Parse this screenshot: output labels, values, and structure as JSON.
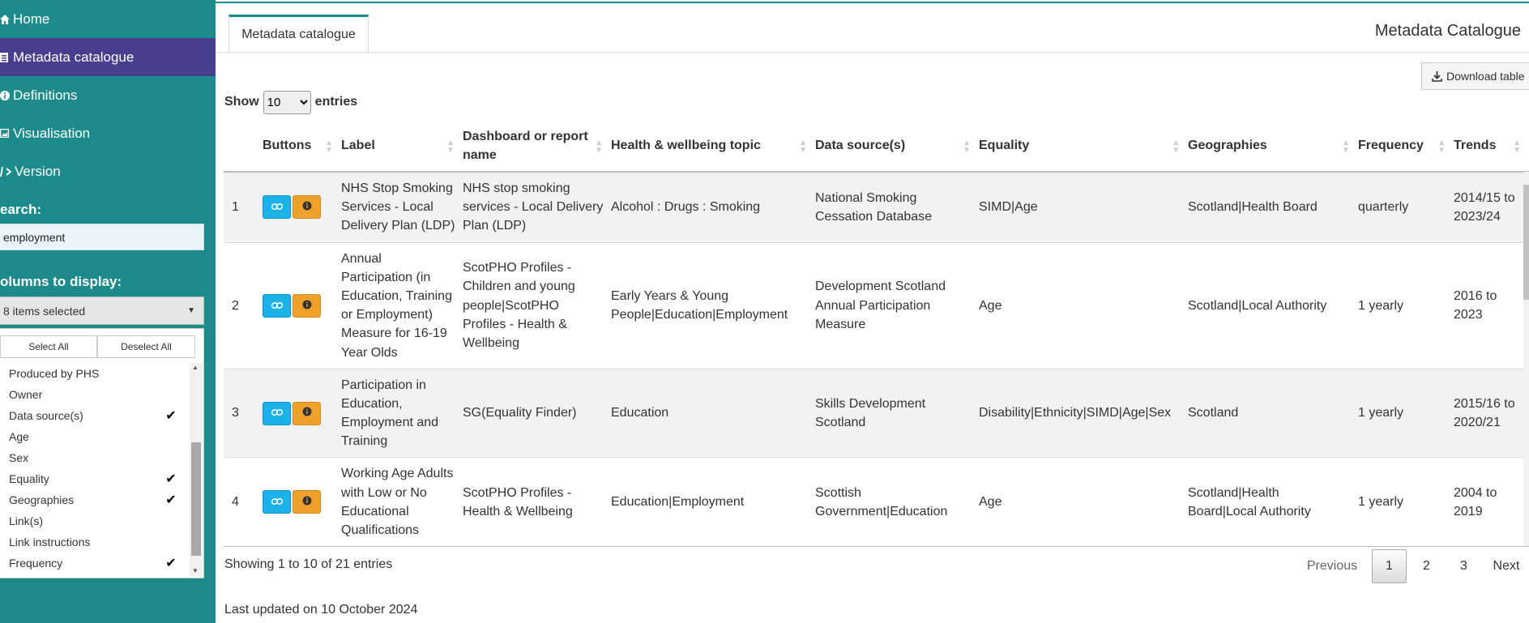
{
  "sidebar": {
    "nav": [
      {
        "label": "Home",
        "icon": "home-icon"
      },
      {
        "label": "Metadata catalogue",
        "icon": "table-icon"
      },
      {
        "label": "Definitions",
        "icon": "info-icon"
      },
      {
        "label": "Visualisation",
        "icon": "image-icon"
      },
      {
        "label": "Version",
        "icon": "code-icon"
      }
    ],
    "search_label": "earch:",
    "search_value": "employment",
    "columns_label": "olumns to display:",
    "columns_selected": "8 items selected",
    "select_all": "Select All",
    "deselect_all": "Deselect All",
    "options": [
      {
        "label": "Produced by PHS",
        "checked": ""
      },
      {
        "label": "Owner",
        "checked": ""
      },
      {
        "label": "Data source(s)",
        "checked": "✔"
      },
      {
        "label": "Age",
        "checked": ""
      },
      {
        "label": "Sex",
        "checked": ""
      },
      {
        "label": "Equality",
        "checked": "✔"
      },
      {
        "label": "Geographies",
        "checked": "✔"
      },
      {
        "label": "Link(s)",
        "checked": ""
      },
      {
        "label": "Link instructions",
        "checked": ""
      },
      {
        "label": "Frequency",
        "checked": "✔"
      }
    ]
  },
  "main": {
    "tab": "Metadata catalogue",
    "title": "Metadata Catalogue",
    "download": "Download table",
    "show": "Show",
    "entries_value": "10",
    "entries": "entries",
    "columns": [
      "",
      "Buttons",
      "Label",
      "Dashboard or report name",
      "Health & wellbeing topic",
      "Data source(s)",
      "Equality",
      "Geographies",
      "Frequency",
      "Trends"
    ],
    "rows": [
      {
        "n": "1",
        "label": "NHS Stop Smoking Services - Local Delivery Plan (LDP)",
        "dashboard": "NHS stop smoking services - Local Delivery Plan (LDP)",
        "topic": "Alcohol : Drugs : Smoking",
        "source": "National Smoking Cessation Database",
        "equality": "SIMD|Age",
        "geo": "Scotland|Health Board",
        "freq": "quarterly",
        "trends": "2014/15 to 2023/24"
      },
      {
        "n": "2",
        "label": "Annual Participation (in Education, Training or Employment) Measure for 16-19 Year Olds",
        "dashboard": "ScotPHO Profiles - Children and young people|ScotPHO Profiles - Health & Wellbeing",
        "topic": "Early Years & Young People|Education|Employment",
        "source": "Development Scotland Annual Participation Measure",
        "equality": "Age",
        "geo": "Scotland|Local Authority",
        "freq": "1 yearly",
        "trends": "2016 to 2023"
      },
      {
        "n": "3",
        "label": "Participation in Education, Employment and Training",
        "dashboard": "SG(Equality Finder)",
        "topic": "Education",
        "source": "Skills Development Scotland",
        "equality": "Disability|Ethnicity|SIMD|Age|Sex",
        "geo": "Scotland",
        "freq": "1 yearly",
        "trends": "2015/16 to 2020/21"
      },
      {
        "n": "4",
        "label": "Working Age Adults with Low or No Educational Qualifications",
        "dashboard": "ScotPHO Profiles - Health & Wellbeing",
        "topic": "Education|Employment",
        "source": "Scottish Government|Education",
        "equality": "Age",
        "geo": "Scotland|Health Board|Local Authority",
        "freq": "1 yearly",
        "trends": "2004 to 2019"
      }
    ],
    "info": "Showing 1 to 10 of 21 entries",
    "pagination": {
      "previous": "Previous",
      "pages": [
        "1",
        "2",
        "3"
      ],
      "next": "Next"
    },
    "updated": "Last updated on 10 October 2024"
  },
  "colors": {
    "sidebar": "#1d8b8b",
    "active_nav": "#473f8d",
    "link_button": "#1ab2e8",
    "info_button": "#f0a12c"
  }
}
